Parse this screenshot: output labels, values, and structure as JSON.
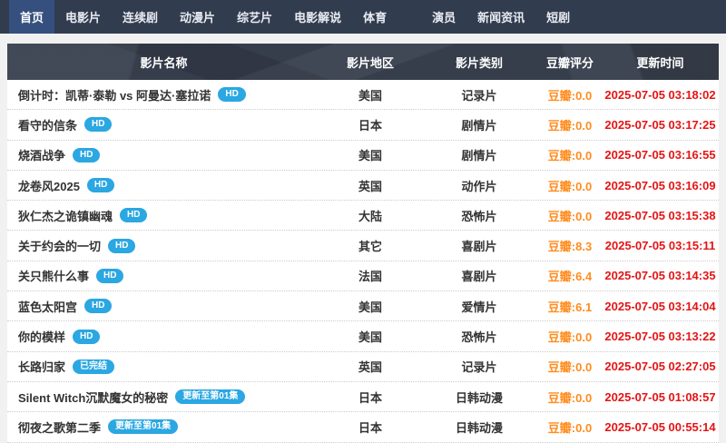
{
  "nav": {
    "items": [
      {
        "label": "首页",
        "active": true
      },
      {
        "label": "电影片",
        "active": false
      },
      {
        "label": "连续剧",
        "active": false
      },
      {
        "label": "动漫片",
        "active": false
      },
      {
        "label": "综艺片",
        "active": false
      },
      {
        "label": "电影解说",
        "active": false
      },
      {
        "label": "体育",
        "active": false
      },
      {
        "label": "演员",
        "active": false
      },
      {
        "label": "新闻资讯",
        "active": false
      },
      {
        "label": "短剧",
        "active": false
      }
    ]
  },
  "table": {
    "columns": [
      "影片名称",
      "影片地区",
      "影片类别",
      "豆瓣评分",
      "更新时间"
    ],
    "rows": [
      {
        "title": "倒计时：凯蒂·泰勒 vs 阿曼达·塞拉诺",
        "badge": "HD",
        "region": "美国",
        "category": "记录片",
        "rating": "豆瓣:0.0",
        "time": "2025-07-05 03:18:02"
      },
      {
        "title": "看守的信条",
        "badge": "HD",
        "region": "日本",
        "category": "剧情片",
        "rating": "豆瓣:0.0",
        "time": "2025-07-05 03:17:25"
      },
      {
        "title": "烧酒战争",
        "badge": "HD",
        "region": "美国",
        "category": "剧情片",
        "rating": "豆瓣:0.0",
        "time": "2025-07-05 03:16:55"
      },
      {
        "title": "龙卷风2025",
        "badge": "HD",
        "region": "英国",
        "category": "动作片",
        "rating": "豆瓣:0.0",
        "time": "2025-07-05 03:16:09"
      },
      {
        "title": "狄仁杰之诡镇幽魂",
        "badge": "HD",
        "region": "大陆",
        "category": "恐怖片",
        "rating": "豆瓣:0.0",
        "time": "2025-07-05 03:15:38"
      },
      {
        "title": "关于约会的一切",
        "badge": "HD",
        "region": "其它",
        "category": "喜剧片",
        "rating": "豆瓣:8.3",
        "time": "2025-07-05 03:15:11"
      },
      {
        "title": "关只熊什么事",
        "badge": "HD",
        "region": "法国",
        "category": "喜剧片",
        "rating": "豆瓣:6.4",
        "time": "2025-07-05 03:14:35"
      },
      {
        "title": "蓝色太阳宫",
        "badge": "HD",
        "region": "美国",
        "category": "爱情片",
        "rating": "豆瓣:6.1",
        "time": "2025-07-05 03:14:04"
      },
      {
        "title": "你的模样",
        "badge": "HD",
        "region": "美国",
        "category": "恐怖片",
        "rating": "豆瓣:0.0",
        "time": "2025-07-05 03:13:22"
      },
      {
        "title": "长路归家",
        "badge": "已完结",
        "region": "英国",
        "category": "记录片",
        "rating": "豆瓣:0.0",
        "time": "2025-07-05 02:27:05"
      },
      {
        "title": "Silent Witch沉默魔女的秘密",
        "badge": "更新至第01集",
        "region": "日本",
        "category": "日韩动漫",
        "rating": "豆瓣:0.0",
        "time": "2025-07-05 01:08:57"
      },
      {
        "title": "彻夜之歌第二季",
        "badge": "更新至第01集",
        "region": "日本",
        "category": "日韩动漫",
        "rating": "豆瓣:0.0",
        "time": "2025-07-05 00:55:14"
      }
    ]
  },
  "colors": {
    "nav_background": "#323c4f",
    "nav_active_background": "#35507e",
    "header_background": "#363e4c",
    "badge_blue": "#2ba7e2",
    "rating_orange": "#ff8c1e",
    "time_red": "#e51414"
  }
}
